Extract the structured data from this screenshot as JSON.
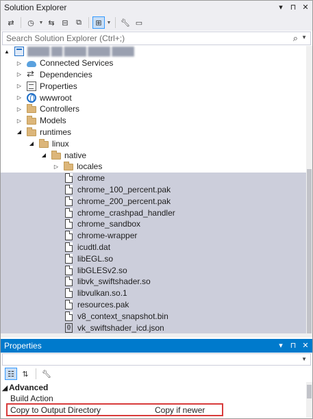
{
  "solution_explorer": {
    "title": "Solution Explorer",
    "title_buttons": [
      "▾",
      "⊓",
      "✕"
    ],
    "search_placeholder": "Search Solution Explorer (Ctrl+;)",
    "toolbar_icons": [
      "sync-with-document-icon",
      "history-icon",
      "pending-changes-icon",
      "collapse-all-icon",
      "show-all-files-icon",
      "preview-selected-icon",
      "properties-wrench-icon",
      "switch-views-icon"
    ],
    "tree": [
      {
        "label": "████ ██ ████ ████ ████",
        "icon": "project-icon",
        "arrow": "▲",
        "indent": 0,
        "blurred": true
      },
      {
        "label": "Connected Services",
        "icon": "cloud-icon",
        "arrow": "▷",
        "indent": 1
      },
      {
        "label": "Dependencies",
        "icon": "dependencies-icon",
        "arrow": "▷",
        "indent": 1
      },
      {
        "label": "Properties",
        "icon": "properties-icon",
        "arrow": "▷",
        "indent": 1
      },
      {
        "label": "wwwroot",
        "icon": "globe-icon",
        "arrow": "▷",
        "indent": 1
      },
      {
        "label": "Controllers",
        "icon": "folder-icon",
        "arrow": "▷",
        "indent": 1
      },
      {
        "label": "Models",
        "icon": "folder-icon",
        "arrow": "▷",
        "indent": 1
      },
      {
        "label": "runtimes",
        "icon": "folder-icon",
        "arrow": "◢",
        "indent": 1
      },
      {
        "label": "linux",
        "icon": "folder-icon",
        "arrow": "◢",
        "indent": 2
      },
      {
        "label": "native",
        "icon": "folder-icon",
        "arrow": "◢",
        "indent": 3
      },
      {
        "label": "locales",
        "icon": "folder-icon",
        "arrow": "▷",
        "indent": 4
      },
      {
        "label": "chrome",
        "icon": "file-icon",
        "arrow": "",
        "indent": 4,
        "selected": true
      },
      {
        "label": "chrome_100_percent.pak",
        "icon": "file-icon",
        "arrow": "",
        "indent": 4,
        "selected": true
      },
      {
        "label": "chrome_200_percent.pak",
        "icon": "file-icon",
        "arrow": "",
        "indent": 4,
        "selected": true
      },
      {
        "label": "chrome_crashpad_handler",
        "icon": "file-icon",
        "arrow": "",
        "indent": 4,
        "selected": true
      },
      {
        "label": "chrome_sandbox",
        "icon": "file-icon",
        "arrow": "",
        "indent": 4,
        "selected": true
      },
      {
        "label": "chrome-wrapper",
        "icon": "file-icon",
        "arrow": "",
        "indent": 4,
        "selected": true
      },
      {
        "label": "icudtl.dat",
        "icon": "file-icon",
        "arrow": "",
        "indent": 4,
        "selected": true
      },
      {
        "label": "libEGL.so",
        "icon": "file-icon",
        "arrow": "",
        "indent": 4,
        "selected": true
      },
      {
        "label": "libGLESv2.so",
        "icon": "file-icon",
        "arrow": "",
        "indent": 4,
        "selected": true
      },
      {
        "label": "libvk_swiftshader.so",
        "icon": "file-icon",
        "arrow": "",
        "indent": 4,
        "selected": true
      },
      {
        "label": "libvulkan.so.1",
        "icon": "file-icon",
        "arrow": "",
        "indent": 4,
        "selected": true
      },
      {
        "label": "resources.pak",
        "icon": "file-icon",
        "arrow": "",
        "indent": 4,
        "selected": true
      },
      {
        "label": "v8_context_snapshot.bin",
        "icon": "file-icon",
        "arrow": "",
        "indent": 4,
        "selected": true
      },
      {
        "label": "vk_swiftshader_icd.json",
        "icon": "json-file-icon",
        "arrow": "",
        "indent": 4,
        "selected": true
      }
    ]
  },
  "properties": {
    "title": "Properties",
    "title_buttons": [
      "▾",
      "⊓",
      "✕"
    ],
    "toolbar_icons": [
      "categorized-icon",
      "alphabetical-icon",
      "property-pages-icon"
    ],
    "category": {
      "label": "Advanced",
      "expander": "◢"
    },
    "rows": [
      {
        "name": "Build Action",
        "value": ""
      },
      {
        "name": "Copy to Output Directory",
        "value": "Copy if newer",
        "highlighted": true
      }
    ]
  },
  "colors": {
    "selection": "#cccedb",
    "accent": "#007acc",
    "highlight_border": "#d83b3b"
  }
}
